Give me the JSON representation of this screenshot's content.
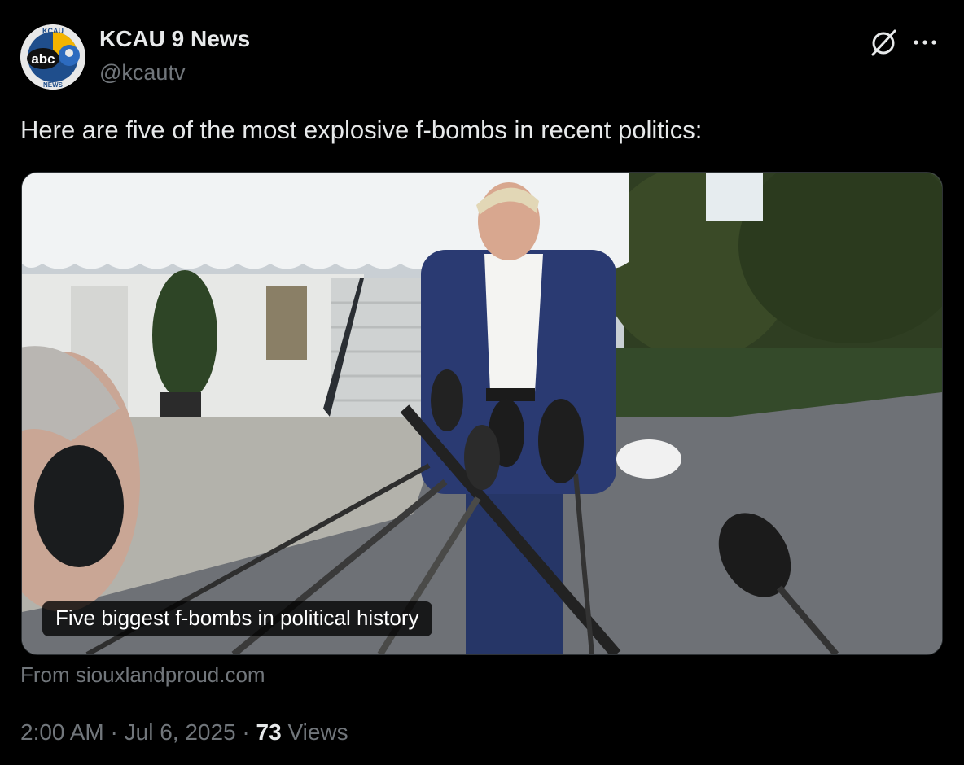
{
  "author": {
    "name": "KCAU 9 News",
    "handle": "@kcautv",
    "avatar_text": "abc",
    "avatar_ring_text_top": "KCAU",
    "avatar_ring_text_bottom": "NEWS"
  },
  "post": {
    "text": "Here are five of the most explosive f-bombs in recent politics:"
  },
  "card": {
    "title": "Five biggest f-bombs in political history",
    "source": "From siouxlandproud.com",
    "image_description_icon": "photo-thumbnail"
  },
  "meta": {
    "time": "2:00 AM",
    "separator1": " · ",
    "date": "Jul 6, 2025",
    "separator2": " · ",
    "views_count": "73",
    "views_label": " Views"
  },
  "icons": {
    "grok": "grok-icon",
    "more": "more-dots-icon"
  },
  "colors": {
    "background": "#000000",
    "primary_text": "#e7e9ea",
    "secondary_text": "#71767b",
    "border": "#2f3336"
  }
}
